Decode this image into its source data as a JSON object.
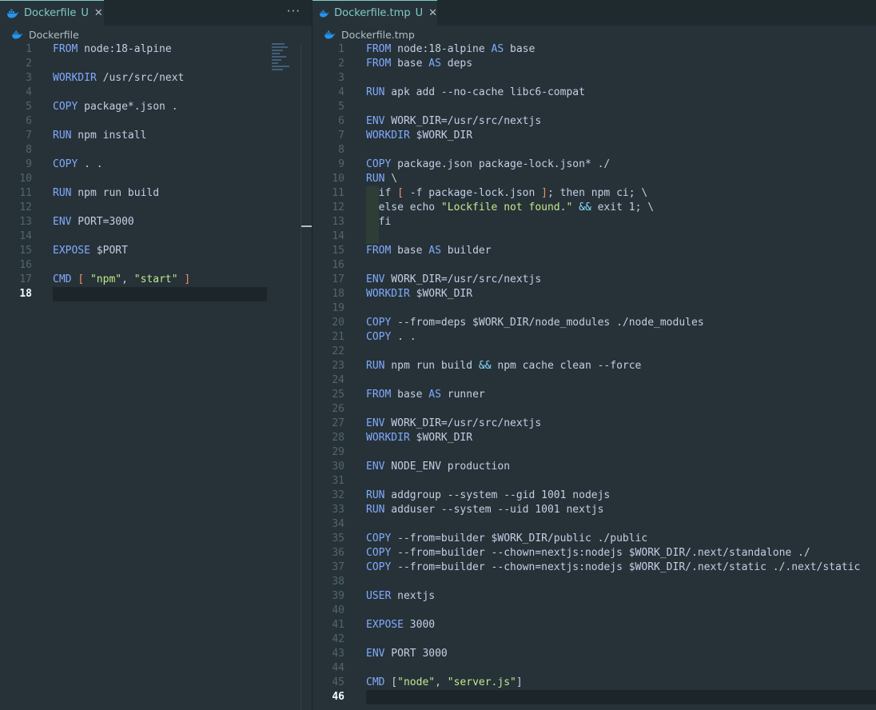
{
  "left": {
    "tab": {
      "name": "Dockerfile",
      "status": "U",
      "close": "✕",
      "icon": "docker-whale-icon"
    },
    "more": "···",
    "breadcrumb": "Dockerfile",
    "current_line": 18,
    "lines": [
      [
        [
          "kw",
          "FROM"
        ],
        [
          "p",
          " node:18-alpine"
        ]
      ],
      [],
      [
        [
          "kw",
          "WORKDIR"
        ],
        [
          "p",
          " /usr/src/next"
        ]
      ],
      [],
      [
        [
          "kw",
          "COPY"
        ],
        [
          "p",
          " package*.json ."
        ]
      ],
      [],
      [
        [
          "kw",
          "RUN"
        ],
        [
          "p",
          " npm install"
        ]
      ],
      [],
      [
        [
          "kw",
          "COPY"
        ],
        [
          "p",
          " . ."
        ]
      ],
      [],
      [
        [
          "kw",
          "RUN"
        ],
        [
          "p",
          " npm run build"
        ]
      ],
      [],
      [
        [
          "kw",
          "ENV"
        ],
        [
          "p",
          " PORT=3000"
        ]
      ],
      [],
      [
        [
          "kw",
          "EXPOSE"
        ],
        [
          "p",
          " $PORT"
        ]
      ],
      [],
      [
        [
          "kw",
          "CMD"
        ],
        [
          "p",
          " "
        ],
        [
          "brk",
          "["
        ],
        [
          "p",
          " "
        ],
        [
          "str",
          "\"npm\""
        ],
        [
          "p",
          ", "
        ],
        [
          "str",
          "\"start\""
        ],
        [
          "p",
          " "
        ],
        [
          "brk",
          "]"
        ]
      ],
      []
    ]
  },
  "right": {
    "tab": {
      "name": "Dockerfile.tmp",
      "status": "U",
      "close": "✕",
      "icon": "docker-whale-icon"
    },
    "breadcrumb": "Dockerfile.tmp",
    "current_line": 46,
    "lines": [
      [
        [
          "kw",
          "FROM"
        ],
        [
          "p",
          " node:18-alpine "
        ],
        [
          "kw",
          "AS"
        ],
        [
          "p",
          " base"
        ]
      ],
      [
        [
          "kw",
          "FROM"
        ],
        [
          "p",
          " base "
        ],
        [
          "kw",
          "AS"
        ],
        [
          "p",
          " deps"
        ]
      ],
      [],
      [
        [
          "kw",
          "RUN"
        ],
        [
          "p",
          " apk add --no-cache libc6-compat"
        ]
      ],
      [],
      [
        [
          "kw",
          "ENV"
        ],
        [
          "p",
          " WORK_DIR=/usr/src/nextjs"
        ]
      ],
      [
        [
          "kw",
          "WORKDIR"
        ],
        [
          "p",
          " $WORK_DIR"
        ]
      ],
      [],
      [
        [
          "kw",
          "COPY"
        ],
        [
          "p",
          " package.json package-lock.json* ./"
        ]
      ],
      [
        [
          "kw",
          "RUN"
        ],
        [
          "p",
          " \\"
        ]
      ],
      [
        [
          "p",
          "  if "
        ],
        [
          "brk",
          "["
        ],
        [
          "p",
          " -f package-lock.json "
        ],
        [
          "brk",
          "]"
        ],
        [
          "p",
          "; then npm ci; \\"
        ]
      ],
      [
        [
          "p",
          "  else echo "
        ],
        [
          "str",
          "\"Lockfile not found.\""
        ],
        [
          "p",
          " "
        ],
        [
          "amp",
          "&&"
        ],
        [
          "p",
          " exit 1; \\"
        ]
      ],
      [
        [
          "p",
          "  fi"
        ]
      ],
      [],
      [
        [
          "kw",
          "FROM"
        ],
        [
          "p",
          " base "
        ],
        [
          "kw",
          "AS"
        ],
        [
          "p",
          " builder"
        ]
      ],
      [],
      [
        [
          "kw",
          "ENV"
        ],
        [
          "p",
          " WORK_DIR=/usr/src/nextjs"
        ]
      ],
      [
        [
          "kw",
          "WORKDIR"
        ],
        [
          "p",
          " $WORK_DIR"
        ]
      ],
      [],
      [
        [
          "kw",
          "COPY"
        ],
        [
          "p",
          " --from=deps $WORK_DIR/node_modules ./node_modules"
        ]
      ],
      [
        [
          "kw",
          "COPY"
        ],
        [
          "p",
          " . ."
        ]
      ],
      [],
      [
        [
          "kw",
          "RUN"
        ],
        [
          "p",
          " npm run build "
        ],
        [
          "amp",
          "&&"
        ],
        [
          "p",
          " npm cache clean --force"
        ]
      ],
      [],
      [
        [
          "kw",
          "FROM"
        ],
        [
          "p",
          " base "
        ],
        [
          "kw",
          "AS"
        ],
        [
          "p",
          " runner"
        ]
      ],
      [],
      [
        [
          "kw",
          "ENV"
        ],
        [
          "p",
          " WORK_DIR=/usr/src/nextjs"
        ]
      ],
      [
        [
          "kw",
          "WORKDIR"
        ],
        [
          "p",
          " $WORK_DIR"
        ]
      ],
      [],
      [
        [
          "kw",
          "ENV"
        ],
        [
          "p",
          " NODE_ENV production"
        ]
      ],
      [],
      [
        [
          "kw",
          "RUN"
        ],
        [
          "p",
          " addgroup --system --gid 1001 nodejs"
        ]
      ],
      [
        [
          "kw",
          "RUN"
        ],
        [
          "p",
          " adduser --system --uid 1001 nextjs"
        ]
      ],
      [],
      [
        [
          "kw",
          "COPY"
        ],
        [
          "p",
          " --from=builder $WORK_DIR/public ./public"
        ]
      ],
      [
        [
          "kw",
          "COPY"
        ],
        [
          "p",
          " --from=builder --chown=nextjs:nodejs $WORK_DIR/.next/standalone ./"
        ]
      ],
      [
        [
          "kw",
          "COPY"
        ],
        [
          "p",
          " --from=builder --chown=nextjs:nodejs $WORK_DIR/.next/static ./.next/static"
        ]
      ],
      [],
      [
        [
          "kw",
          "USER"
        ],
        [
          "p",
          " nextjs"
        ]
      ],
      [],
      [
        [
          "kw",
          "EXPOSE"
        ],
        [
          "p",
          " 3000"
        ]
      ],
      [],
      [
        [
          "kw",
          "ENV"
        ],
        [
          "p",
          " PORT 3000"
        ]
      ],
      [],
      [
        [
          "kw",
          "CMD"
        ],
        [
          "p",
          " ["
        ],
        [
          "str",
          "\"node\""
        ],
        [
          "p",
          ", "
        ],
        [
          "str",
          "\"server.js\""
        ],
        [
          "p",
          "]"
        ]
      ],
      []
    ]
  }
}
